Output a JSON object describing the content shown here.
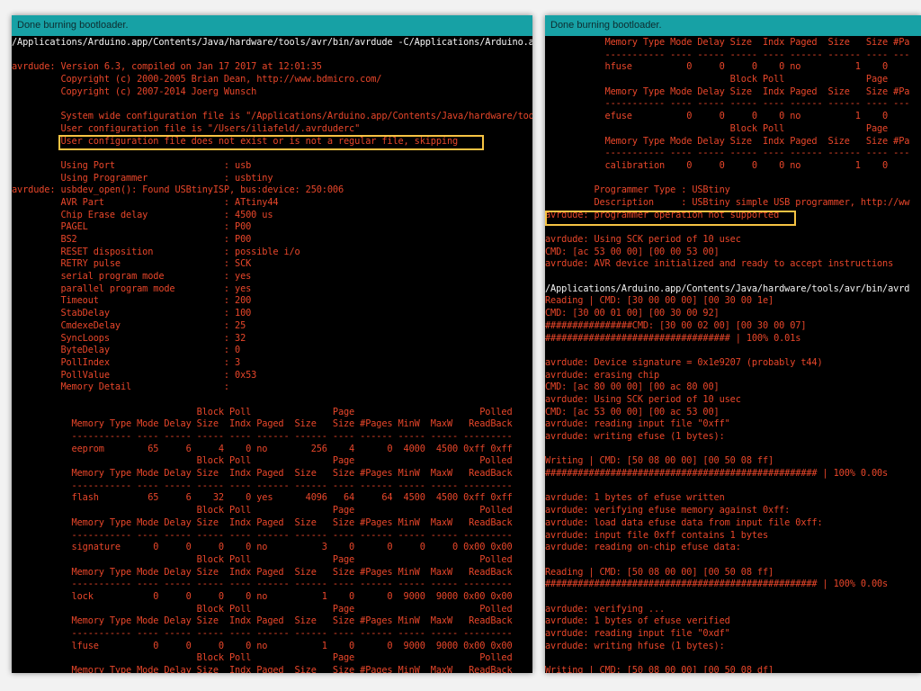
{
  "left_panel": {
    "status": "Done burning bootloader.",
    "lines": [
      {
        "t": "/Applications/Arduino.app/Contents/Java/hardware/tools/avr/bin/avrdude -C/Applications/Arduino.app",
        "w": 1
      },
      {
        "t": "",
        "w": 0
      },
      {
        "t": "avrdude: Version 6.3, compiled on Jan 17 2017 at 12:01:35",
        "w": 0
      },
      {
        "t": "         Copyright (c) 2000-2005 Brian Dean, http://www.bdmicro.com/",
        "w": 0
      },
      {
        "t": "         Copyright (c) 2007-2014 Joerg Wunsch",
        "w": 0
      },
      {
        "t": "",
        "w": 0
      },
      {
        "t": "         System wide configuration file is \"/Applications/Arduino.app/Contents/Java/hardware/tool",
        "w": 0
      },
      {
        "t": "         User configuration file is \"/Users/iliafeld/.avrduderc\"",
        "w": 0
      },
      {
        "t": "         User configuration file does not exist or is not a regular file, skipping",
        "w": 0
      },
      {
        "t": "",
        "w": 0
      },
      {
        "t": "         Using Port                    : usb",
        "w": 0
      },
      {
        "t": "         Using Programmer              : usbtiny",
        "w": 0
      },
      {
        "t": "avrdude: usbdev_open(): Found USBtinyISP, bus:device: 250:006",
        "w": 0
      },
      {
        "t": "         AVR Part                      : ATtiny44",
        "w": 0
      },
      {
        "t": "         Chip Erase delay              : 4500 us",
        "w": 0
      },
      {
        "t": "         PAGEL                         : P00",
        "w": 0
      },
      {
        "t": "         BS2                           : P00",
        "w": 0
      },
      {
        "t": "         RESET disposition             : possible i/o",
        "w": 0
      },
      {
        "t": "         RETRY pulse                   : SCK",
        "w": 0
      },
      {
        "t": "         serial program mode           : yes",
        "w": 0
      },
      {
        "t": "         parallel program mode         : yes",
        "w": 0
      },
      {
        "t": "         Timeout                       : 200",
        "w": 0
      },
      {
        "t": "         StabDelay                     : 100",
        "w": 0
      },
      {
        "t": "         CmdexeDelay                   : 25",
        "w": 0
      },
      {
        "t": "         SyncLoops                     : 32",
        "w": 0
      },
      {
        "t": "         ByteDelay                     : 0",
        "w": 0
      },
      {
        "t": "         PollIndex                     : 3",
        "w": 0
      },
      {
        "t": "         PollValue                     : 0x53",
        "w": 0
      },
      {
        "t": "         Memory Detail                 :",
        "w": 0
      },
      {
        "t": "",
        "w": 0
      },
      {
        "t": "                                  Block Poll               Page                       Polled",
        "w": 0
      },
      {
        "t": "           Memory Type Mode Delay Size  Indx Paged  Size   Size #Pages MinW  MaxW   ReadBack",
        "w": 0
      },
      {
        "t": "           ----------- ---- ----- ----- ---- ------ ------ ---- ------ ----- ----- ---------",
        "w": 0
      },
      {
        "t": "           eeprom        65     6     4    0 no        256    4      0  4000  4500 0xff 0xff",
        "w": 0
      },
      {
        "t": "                                  Block Poll               Page                       Polled",
        "w": 0
      },
      {
        "t": "           Memory Type Mode Delay Size  Indx Paged  Size   Size #Pages MinW  MaxW   ReadBack",
        "w": 0
      },
      {
        "t": "           ----------- ---- ----- ----- ---- ------ ------ ---- ------ ----- ----- ---------",
        "w": 0
      },
      {
        "t": "           flash         65     6    32    0 yes      4096   64     64  4500  4500 0xff 0xff",
        "w": 0
      },
      {
        "t": "                                  Block Poll               Page                       Polled",
        "w": 0
      },
      {
        "t": "           Memory Type Mode Delay Size  Indx Paged  Size   Size #Pages MinW  MaxW   ReadBack",
        "w": 0
      },
      {
        "t": "           ----------- ---- ----- ----- ---- ------ ------ ---- ------ ----- ----- ---------",
        "w": 0
      },
      {
        "t": "           signature      0     0     0    0 no          3    0      0     0     0 0x00 0x00",
        "w": 0
      },
      {
        "t": "                                  Block Poll               Page                       Polled",
        "w": 0
      },
      {
        "t": "           Memory Type Mode Delay Size  Indx Paged  Size   Size #Pages MinW  MaxW   ReadBack",
        "w": 0
      },
      {
        "t": "           ----------- ---- ----- ----- ---- ------ ------ ---- ------ ----- ----- ---------",
        "w": 0
      },
      {
        "t": "           lock           0     0     0    0 no          1    0      0  9000  9000 0x00 0x00",
        "w": 0
      },
      {
        "t": "                                  Block Poll               Page                       Polled",
        "w": 0
      },
      {
        "t": "           Memory Type Mode Delay Size  Indx Paged  Size   Size #Pages MinW  MaxW   ReadBack",
        "w": 0
      },
      {
        "t": "           ----------- ---- ----- ----- ---- ------ ------ ---- ------ ----- ----- ---------",
        "w": 0
      },
      {
        "t": "           lfuse          0     0     0    0 no          1    0      0  9000  9000 0x00 0x00",
        "w": 0
      },
      {
        "t": "                                  Block Poll               Page                       Polled",
        "w": 0
      },
      {
        "t": "           Memory Type Mode Delay Size  Indx Paged  Size   Size #Pages MinW  MaxW   ReadBack",
        "w": 0
      }
    ]
  },
  "right_panel": {
    "status": "Done burning bootloader.",
    "lines": [
      {
        "t": "           Memory Type Mode Delay Size  Indx Paged  Size   Size #Pa",
        "w": 0
      },
      {
        "t": "           ----------- ---- ----- ----- ---- ------ ------ ---- ---",
        "w": 0
      },
      {
        "t": "           hfuse          0     0     0    0 no          1    0",
        "w": 0
      },
      {
        "t": "                                  Block Poll               Page",
        "w": 0
      },
      {
        "t": "           Memory Type Mode Delay Size  Indx Paged  Size   Size #Pa",
        "w": 0
      },
      {
        "t": "           ----------- ---- ----- ----- ---- ------ ------ ---- ---",
        "w": 0
      },
      {
        "t": "           efuse          0     0     0    0 no          1    0",
        "w": 0
      },
      {
        "t": "                                  Block Poll               Page",
        "w": 0
      },
      {
        "t": "           Memory Type Mode Delay Size  Indx Paged  Size   Size #Pa",
        "w": 0
      },
      {
        "t": "           ----------- ---- ----- ----- ---- ------ ------ ---- ---",
        "w": 0
      },
      {
        "t": "           calibration    0     0     0    0 no          1    0",
        "w": 0
      },
      {
        "t": "",
        "w": 0
      },
      {
        "t": "         Programmer Type : USBtiny",
        "w": 0
      },
      {
        "t": "         Description     : USBtiny simple USB programmer, http://ww",
        "w": 0
      },
      {
        "t": "avrdude: programmer operation not supported",
        "w": 0
      },
      {
        "t": "",
        "w": 0
      },
      {
        "t": "avrdude: Using SCK period of 10 usec",
        "w": 0
      },
      {
        "t": "CMD: [ac 53 00 00] [00 00 53 00]",
        "w": 0
      },
      {
        "t": "avrdude: AVR device initialized and ready to accept instructions",
        "w": 0
      },
      {
        "t": "",
        "w": 0
      },
      {
        "t": "/Applications/Arduino.app/Contents/Java/hardware/tools/avr/bin/avrd",
        "w": 1
      },
      {
        "t": "Reading | CMD: [30 00 00 00] [00 30 00 1e]",
        "w": 0
      },
      {
        "t": "CMD: [30 00 01 00] [00 30 00 92]",
        "w": 0
      },
      {
        "t": "################CMD: [30 00 02 00] [00 30 00 07]",
        "w": 0
      },
      {
        "t": "################################## | 100% 0.01s",
        "w": 0
      },
      {
        "t": "",
        "w": 0
      },
      {
        "t": "avrdude: Device signature = 0x1e9207 (probably t44)",
        "w": 0
      },
      {
        "t": "avrdude: erasing chip",
        "w": 0
      },
      {
        "t": "CMD: [ac 80 00 00] [00 ac 80 00]",
        "w": 0
      },
      {
        "t": "avrdude: Using SCK period of 10 usec",
        "w": 0
      },
      {
        "t": "CMD: [ac 53 00 00] [00 ac 53 00]",
        "w": 0
      },
      {
        "t": "avrdude: reading input file \"0xff\"",
        "w": 0
      },
      {
        "t": "avrdude: writing efuse (1 bytes):",
        "w": 0
      },
      {
        "t": "",
        "w": 0
      },
      {
        "t": "Writing | CMD: [50 08 00 00] [00 50 08 ff]",
        "w": 0
      },
      {
        "t": "################################################## | 100% 0.00s",
        "w": 0
      },
      {
        "t": "",
        "w": 0
      },
      {
        "t": "avrdude: 1 bytes of efuse written",
        "w": 0
      },
      {
        "t": "avrdude: verifying efuse memory against 0xff:",
        "w": 0
      },
      {
        "t": "avrdude: load data efuse data from input file 0xff:",
        "w": 0
      },
      {
        "t": "avrdude: input file 0xff contains 1 bytes",
        "w": 0
      },
      {
        "t": "avrdude: reading on-chip efuse data:",
        "w": 0
      },
      {
        "t": "",
        "w": 0
      },
      {
        "t": "Reading | CMD: [50 08 00 00] [00 50 08 ff]",
        "w": 0
      },
      {
        "t": "################################################## | 100% 0.00s",
        "w": 0
      },
      {
        "t": "",
        "w": 0
      },
      {
        "t": "avrdude: verifying ...",
        "w": 0
      },
      {
        "t": "avrdude: 1 bytes of efuse verified",
        "w": 0
      },
      {
        "t": "avrdude: reading input file \"0xdf\"",
        "w": 0
      },
      {
        "t": "avrdude: writing hfuse (1 bytes):",
        "w": 0
      },
      {
        "t": "",
        "w": 0
      },
      {
        "t": "Writing | CMD: [50 08 00 00] [00 50 08 df]",
        "w": 0
      }
    ]
  },
  "colors": {
    "console_text": "#e8462a",
    "command_text": "#f4f4f4",
    "status_bar": "#17a1a5",
    "highlight_border": "#f6c343"
  }
}
